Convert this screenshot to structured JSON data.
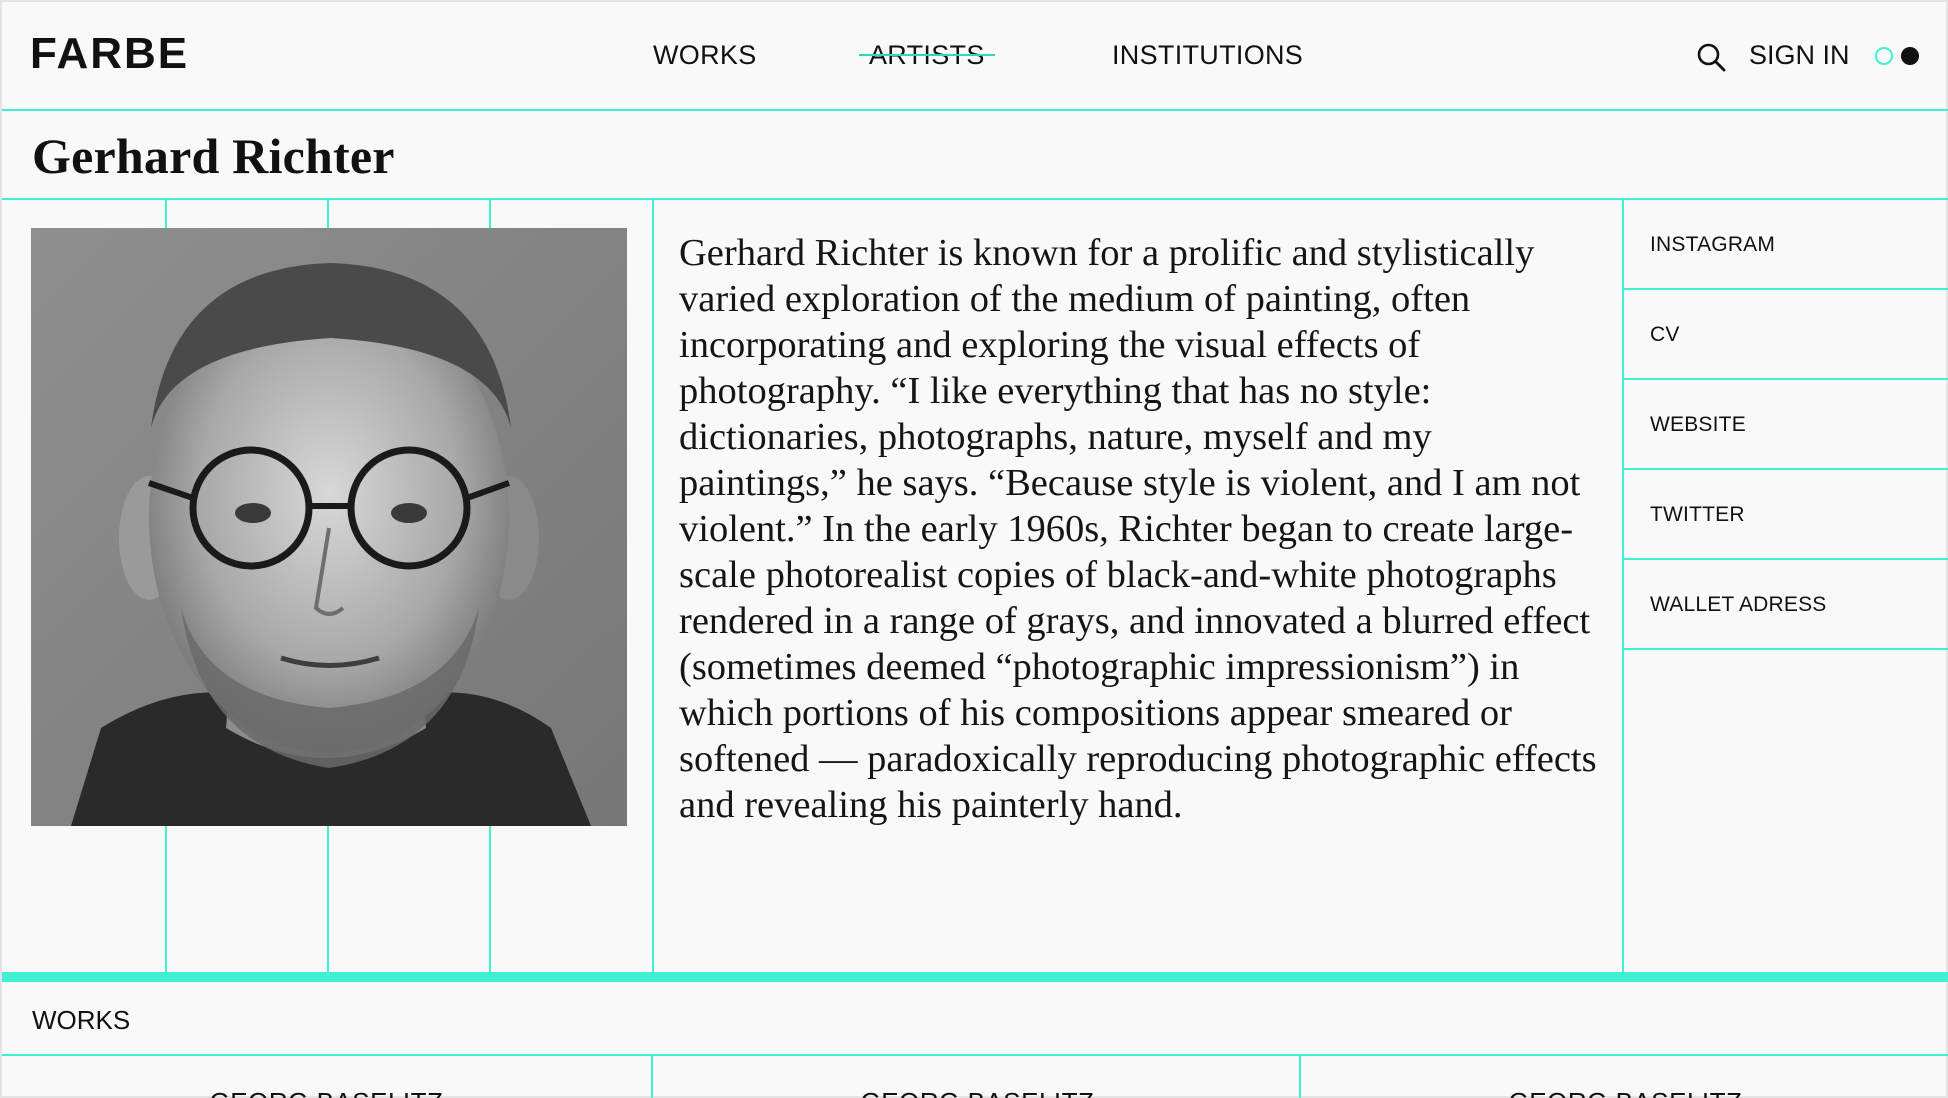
{
  "header": {
    "logo": "FARBE",
    "nav": [
      "WORKS",
      "ARTISTS",
      "INSTITUTIONS"
    ],
    "active_nav": "ARTISTS",
    "sign_in": "SIGN IN",
    "icons": [
      "search-icon",
      "theme-toggle-icon"
    ],
    "accent_color": "#3ff0d4"
  },
  "artist": {
    "name": "Gerhard Richter",
    "bio": "Gerhard Richter is known for a prolific and stylistically varied exploration of the medium of painting, often incorporating and exploring the visual effects of photography. “I like everything that has no style: dictionaries, photographs, nature, myself and my paintings,” he says. “Because style is violent, and I am not violent.” In the early 1960s, Richter began to create large-scale photorealist copies of black-and-white photographs rendered in a range of grays, and innovated a blurred effect (sometimes deemed “photographic impressionism”) in which portions of his compositions appear smeared or softened — paradoxically reproducing photographic effects and revealing his painterly hand."
  },
  "links": [
    "INSTAGRAM",
    "CV",
    "WEBSITE",
    "TWITTER",
    "WALLET ADRESS"
  ],
  "works": {
    "label": "WORKS",
    "cards": [
      "GEORG BASELITZ",
      "GEORG BASELITZ",
      "GEORG BASELITZ"
    ]
  }
}
